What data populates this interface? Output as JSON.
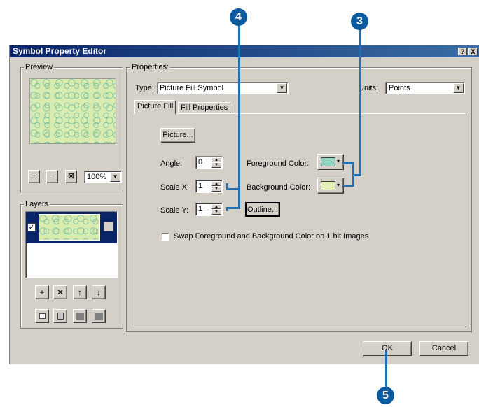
{
  "window": {
    "title": "Symbol Property Editor",
    "help_label": "?",
    "close_label": "X"
  },
  "preview": {
    "group_label": "Preview",
    "zoom_in_label": "+",
    "zoom_out_label": "−",
    "fit_label": "⊠",
    "zoom_value": "100%"
  },
  "layers": {
    "group_label": "Layers",
    "add_label": "+",
    "delete_label": "✕",
    "up_label": "↑",
    "down_label": "↓",
    "checked": "✓"
  },
  "properties": {
    "group_label": "Properties:",
    "type_label": "Type:",
    "type_value": "Picture Fill Symbol",
    "units_label": "Units:",
    "units_value": "Points",
    "tabs": [
      {
        "label": "Picture Fill"
      },
      {
        "label": "Fill Properties"
      }
    ],
    "picture_button": "Picture...",
    "angle_label": "Angle:",
    "angle_value": "0",
    "scale_x_label": "Scale X:",
    "scale_x_value": "1",
    "scale_y_label": "Scale Y:",
    "scale_y_value": "1",
    "fg_label": "Foreground Color:",
    "bg_label": "Background Color:",
    "outline_button": "Outline...",
    "swap_label": "Swap Foreground and Background Color on 1 bit Images",
    "fg_color": "#8fd6c0",
    "bg_color": "#e4f0b4"
  },
  "footer": {
    "ok_label": "OK",
    "cancel_label": "Cancel"
  },
  "callouts": {
    "c4": "4",
    "c3": "3",
    "c5": "5"
  }
}
